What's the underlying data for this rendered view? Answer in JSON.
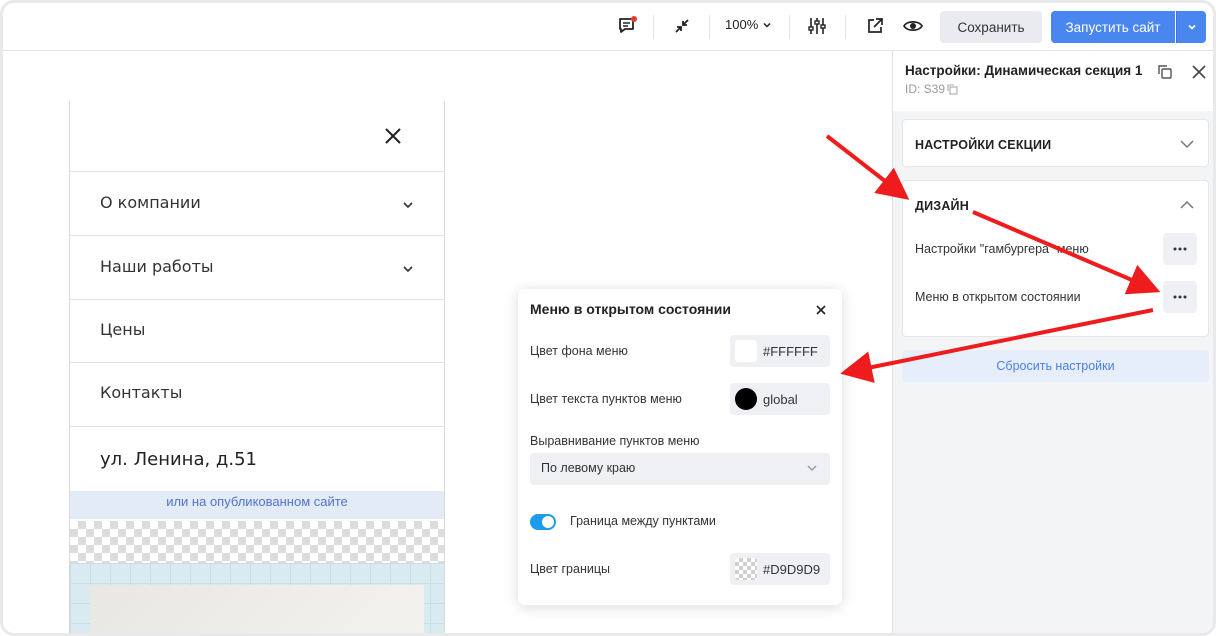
{
  "topbar": {
    "icons": [
      "comment-icon",
      "collapse-icon",
      "settings-sliders-icon",
      "external-link-icon",
      "eye-icon"
    ],
    "zoom": "100%",
    "save_label": "Сохранить",
    "launch_label": "Запустить сайт"
  },
  "preview": {
    "menu_items": [
      {
        "label": "О компании",
        "has_submenu": true
      },
      {
        "label": "Наши работы",
        "has_submenu": true
      },
      {
        "label": "Цены",
        "has_submenu": false
      },
      {
        "label": "Контакты",
        "has_submenu": false
      }
    ],
    "address": "ул. Ленина, д.51",
    "hint": "или на опубликованном сайте"
  },
  "popup": {
    "title": "Меню в открытом состоянии",
    "bg_label": "Цвет фона меню",
    "bg_value": "#FFFFFF",
    "text_label": "Цвет текста пунктов меню",
    "text_value": "global",
    "align_label": "Выравнивание пунктов меню",
    "align_value": "По левому краю",
    "border_toggle_label": "Граница между пунктами",
    "border_toggle_on": true,
    "border_color_label": "Цвет границы",
    "border_color_value": "#D9D9D9"
  },
  "panel": {
    "title": "Настройки: Динамическая секция 1",
    "id_label": "ID: S39",
    "section_settings": "НАСТРОЙКИ СЕКЦИИ",
    "design": "ДИЗАЙН",
    "hamburger_label": "Настройки \"гамбургера\" меню",
    "open_menu_label": "Меню в открытом состоянии",
    "reset_label": "Сбросить настройки"
  },
  "colors": {
    "accent": "#4a86f0",
    "toggle": "#1e9bea",
    "arrow": "#ee1c1c",
    "notification_dot": "#e53935"
  }
}
